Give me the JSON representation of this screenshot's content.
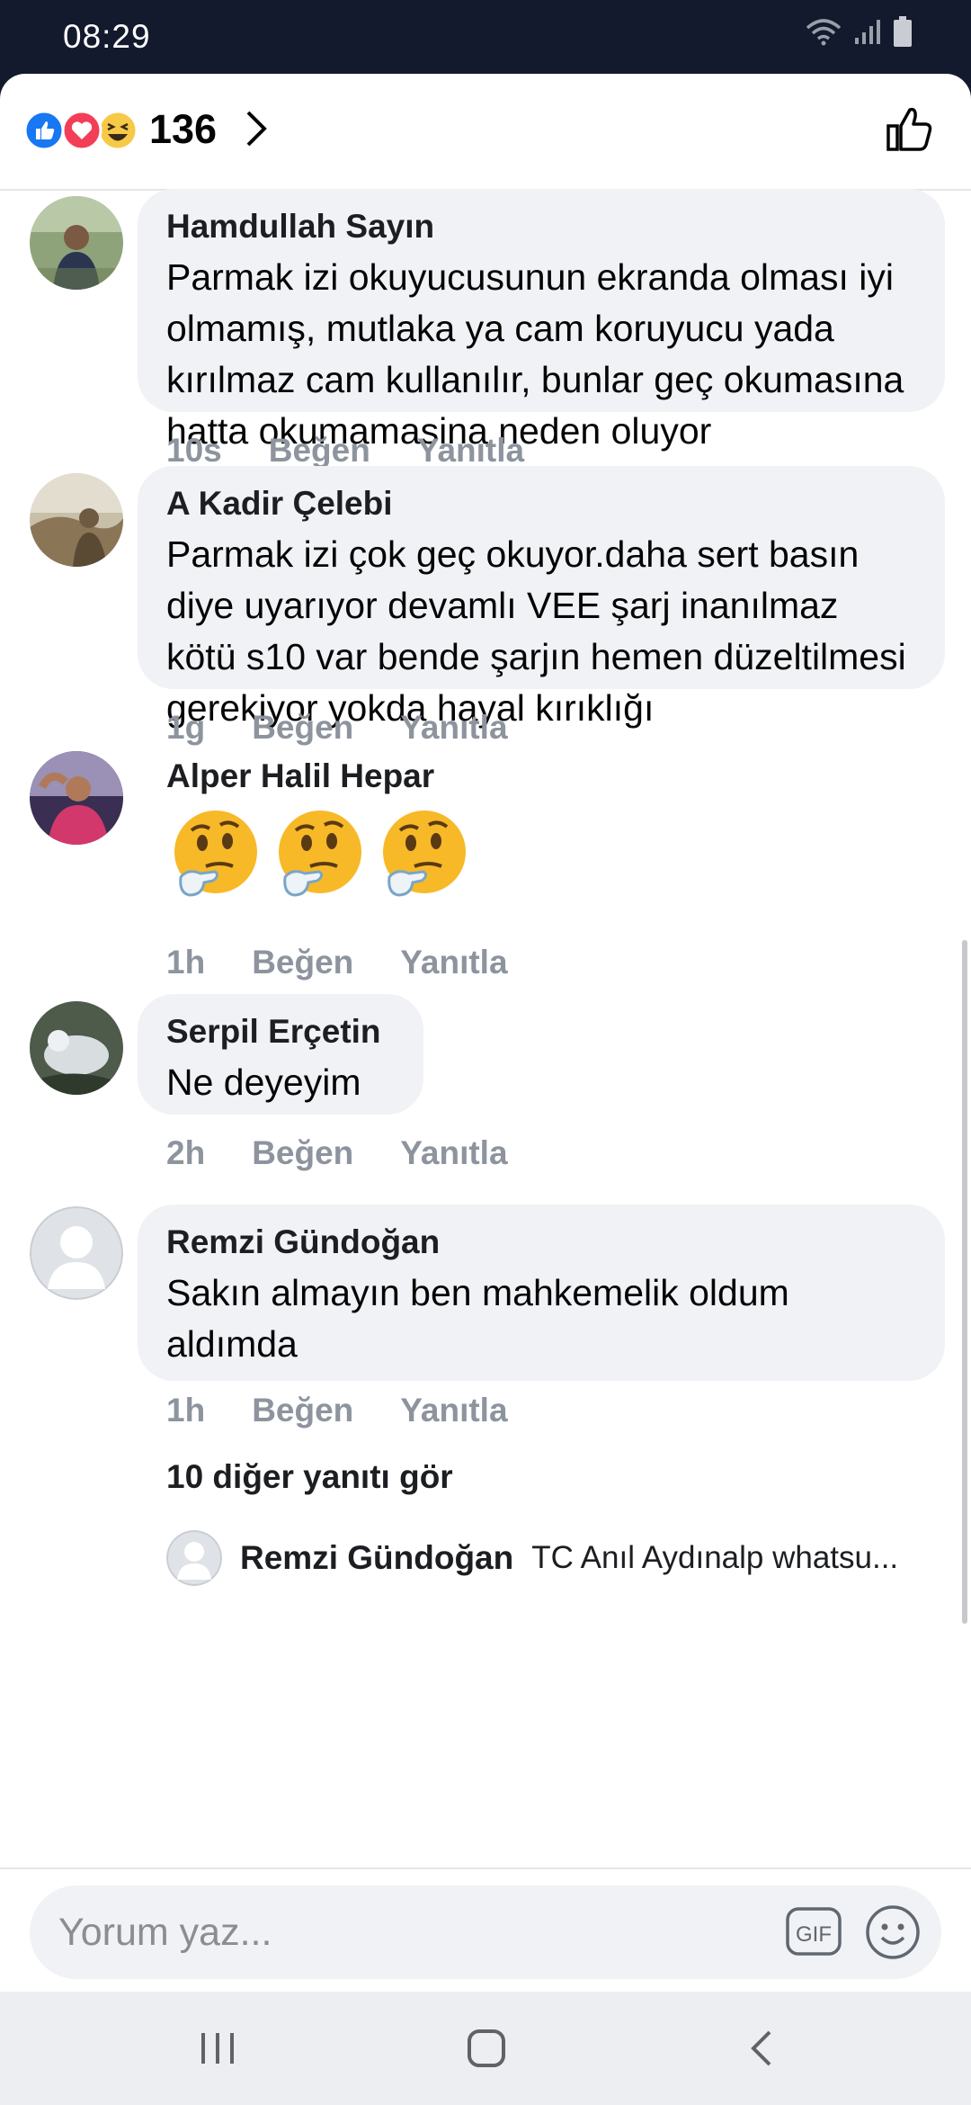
{
  "status_bar": {
    "time": "08:29",
    "icons": [
      "wifi-icon",
      "signal-icon",
      "battery-icon"
    ]
  },
  "reactions": {
    "count": "136",
    "icons": [
      "like-reaction-icon",
      "love-reaction-icon",
      "haha-reaction-icon"
    ]
  },
  "comments": [
    {
      "author": "Hamdullah Sayın",
      "text": "Parmak izi okuyucusunun ekranda olması iyi olmamış, mutlaka ya cam koruyucu yada kırılmaz cam kullanılır, bunlar geç okumasına hatta okumamasina neden oluyor",
      "age": "10s",
      "like": "Beğen",
      "reply": "Yanıtla"
    },
    {
      "author": "A Kadir Çelebi",
      "text": "Parmak izi çok geç okuyor.daha sert basın diye uyarıyor devamlı VEE şarj inanılmaz kötü s10 var bende şarjın hemen düzeltilmesi gerekiyor yokda hayal kırıklığı",
      "age": "1g",
      "like": "Beğen",
      "reply": "Yanıtla"
    },
    {
      "author": "Alper Halil Hepar",
      "emojis": [
        "🤔",
        "🤔",
        "🤔"
      ],
      "age": "1h",
      "like": "Beğen",
      "reply": "Yanıtla"
    },
    {
      "author": "Serpil Erçetin",
      "text": "Ne deyeyim",
      "age": "2h",
      "like": "Beğen",
      "reply": "Yanıtla"
    },
    {
      "author": "Remzi Gündoğan",
      "text": "Sakın almayın ben mahkemelik oldum aldımda",
      "age": "1h",
      "like": "Beğen",
      "reply": "Yanıtla",
      "more_replies": "10 diğer yanıtı gör",
      "reply_preview": {
        "author": "Remzi Gündoğan",
        "text": "TC Anıl Aydınalp  whatsu..."
      }
    }
  ],
  "composer": {
    "placeholder": "Yorum yaz...",
    "gif_label": "GIF"
  },
  "colors": {
    "header_bg": "#131a2e",
    "bubble_bg": "#f0f2f5",
    "meta_text": "#8d949e",
    "like_blue": "#1877f2",
    "love_red": "#f33e58"
  }
}
